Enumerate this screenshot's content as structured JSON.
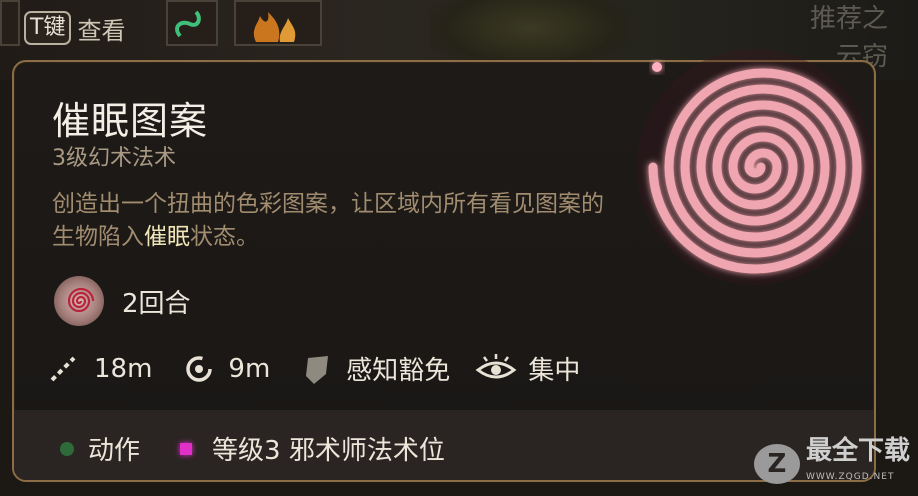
{
  "hint_bar": {
    "key_label": "T键",
    "action_label": "查看",
    "bg_hint_line1": "推荐之",
    "bg_hint_line2": "云窃"
  },
  "spell": {
    "name": "催眠图案",
    "level_school": "3级幻术法术",
    "description_part1": "创造出一个扭曲的色彩图案，让区域内所有看见图案的生物陷入",
    "description_highlight": "催眠",
    "description_part2": "状态。",
    "duration": "2回合",
    "range": "18m",
    "aoe": "9m",
    "save": "感知豁免",
    "concentration": "集中"
  },
  "footer": {
    "action_label": "动作",
    "slot_label": "等级3 邪术师法术位"
  },
  "watermark": {
    "brand": "最全下载",
    "url": "WWW.ZQGD.NET"
  },
  "colors": {
    "border": "#8c6d45",
    "action_dot": "#2f6b3a",
    "slot_square": "#e030c8",
    "spiral": "#f0a6b0",
    "highlight": "#f1e6b8"
  },
  "icons": [
    "swirl-icon",
    "range-icon",
    "aoe-icon",
    "shield-icon",
    "eye-icon",
    "action-dot-icon",
    "spell-slot-icon"
  ]
}
